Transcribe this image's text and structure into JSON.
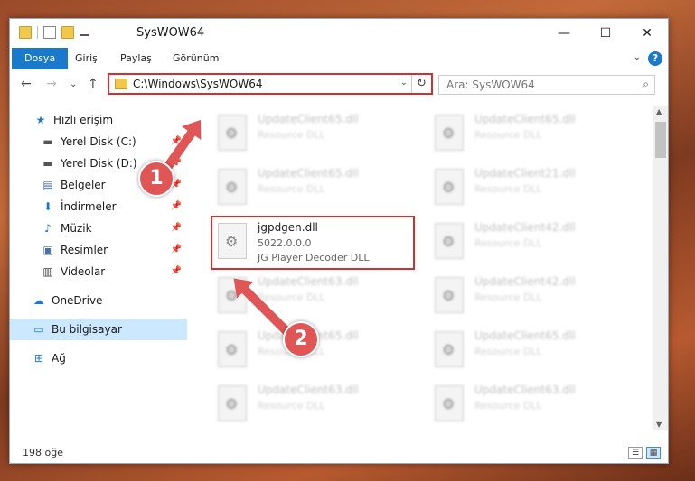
{
  "window": {
    "title": "SysWOW64",
    "minimize": "—",
    "maximize": "☐",
    "close": "✕"
  },
  "ribbon": {
    "tabs": [
      "Dosya",
      "Giriş",
      "Paylaş",
      "Görünüm"
    ],
    "expand": "⌄",
    "help": "?"
  },
  "nav": {
    "back": "←",
    "forward": "→",
    "recent": "⌄",
    "up": "↑",
    "address": "C:\\Windows\\SysWOW64",
    "address_dropdown": "⌄",
    "refresh": "↻",
    "search_placeholder": "Ara: SysWOW64",
    "search_icon": "⌕"
  },
  "sidebar": {
    "items": [
      {
        "label": "Hızlı erişim",
        "icon": "star-icon",
        "glyph": "★",
        "pin": false
      },
      {
        "label": "Yerel Disk (C:)",
        "icon": "drive-icon",
        "glyph": "▬",
        "pin": true
      },
      {
        "label": "Yerel Disk (D:)",
        "icon": "drive-icon",
        "glyph": "▬",
        "pin": true
      },
      {
        "label": "Belgeler",
        "icon": "documents-icon",
        "glyph": "▤",
        "pin": true
      },
      {
        "label": "İndirmeler",
        "icon": "download-icon",
        "glyph": "⬇",
        "pin": true
      },
      {
        "label": "Müzik",
        "icon": "music-icon",
        "glyph": "♪",
        "pin": true
      },
      {
        "label": "Resimler",
        "icon": "pictures-icon",
        "glyph": "▣",
        "pin": true
      },
      {
        "label": "Videolar",
        "icon": "video-icon",
        "glyph": "▥",
        "pin": true
      },
      {
        "label": "OneDrive",
        "icon": "cloud-icon",
        "glyph": "☁",
        "pin": false
      },
      {
        "label": "Bu bilgisayar",
        "icon": "computer-icon",
        "glyph": "▭",
        "pin": false
      },
      {
        "label": "Ağ",
        "icon": "network-icon",
        "glyph": "⊞",
        "pin": false
      }
    ],
    "pin_glyph": "📌"
  },
  "files": [
    {
      "name": "UpdateClient65.dll",
      "desc": "Resource DLL"
    },
    {
      "name": "UpdateClient65.dll",
      "desc": "Resource DLL"
    },
    {
      "name": "UpdateClient65.dll",
      "desc": "Resource DLL"
    },
    {
      "name": "UpdateClient21.dll",
      "desc": "Resource DLL"
    },
    {
      "name": "UpdateClient42.dll",
      "desc": "Resource DLL"
    },
    {
      "name": "UpdateClient63.dll",
      "desc": "Resource DLL"
    },
    {
      "name": "UpdateClient42.dll",
      "desc": "Resource DLL"
    },
    {
      "name": "UpdateClient65.dll",
      "desc": "Resource DLL"
    },
    {
      "name": "UpdateClient65.dll",
      "desc": "Resource DLL"
    },
    {
      "name": "UpdateClient63.dll",
      "desc": "Resource DLL"
    },
    {
      "name": "UpdateClient63.dll",
      "desc": "Resource DLL"
    }
  ],
  "target_file": {
    "name": "jgpdgen.dll",
    "version": "5022.0.0.0",
    "desc": "JG Player Decoder DLL"
  },
  "status": {
    "count": "198 öğe",
    "details_view": "☰",
    "tiles_view": "▦"
  },
  "callouts": [
    "1",
    "2"
  ],
  "colors": {
    "accent": "#1979ca",
    "highlight": "#d32f2f",
    "arrow": "#e05555"
  }
}
